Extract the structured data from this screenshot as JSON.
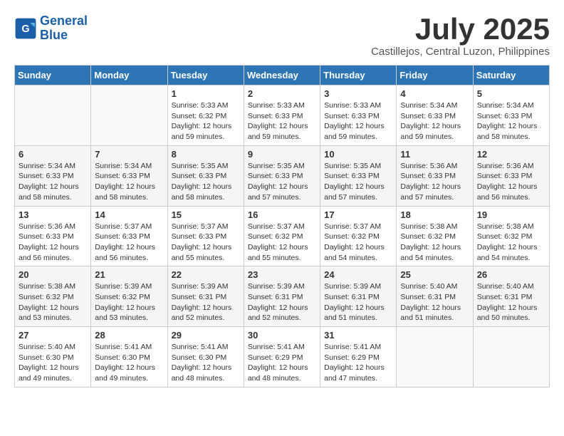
{
  "header": {
    "logo_line1": "General",
    "logo_line2": "Blue",
    "month": "July 2025",
    "location": "Castillejos, Central Luzon, Philippines"
  },
  "weekdays": [
    "Sunday",
    "Monday",
    "Tuesday",
    "Wednesday",
    "Thursday",
    "Friday",
    "Saturday"
  ],
  "weeks": [
    [
      {
        "day": "",
        "info": ""
      },
      {
        "day": "",
        "info": ""
      },
      {
        "day": "1",
        "info": "Sunrise: 5:33 AM\nSunset: 6:32 PM\nDaylight: 12 hours\nand 59 minutes."
      },
      {
        "day": "2",
        "info": "Sunrise: 5:33 AM\nSunset: 6:33 PM\nDaylight: 12 hours\nand 59 minutes."
      },
      {
        "day": "3",
        "info": "Sunrise: 5:33 AM\nSunset: 6:33 PM\nDaylight: 12 hours\nand 59 minutes."
      },
      {
        "day": "4",
        "info": "Sunrise: 5:34 AM\nSunset: 6:33 PM\nDaylight: 12 hours\nand 59 minutes."
      },
      {
        "day": "5",
        "info": "Sunrise: 5:34 AM\nSunset: 6:33 PM\nDaylight: 12 hours\nand 58 minutes."
      }
    ],
    [
      {
        "day": "6",
        "info": "Sunrise: 5:34 AM\nSunset: 6:33 PM\nDaylight: 12 hours\nand 58 minutes."
      },
      {
        "day": "7",
        "info": "Sunrise: 5:34 AM\nSunset: 6:33 PM\nDaylight: 12 hours\nand 58 minutes."
      },
      {
        "day": "8",
        "info": "Sunrise: 5:35 AM\nSunset: 6:33 PM\nDaylight: 12 hours\nand 58 minutes."
      },
      {
        "day": "9",
        "info": "Sunrise: 5:35 AM\nSunset: 6:33 PM\nDaylight: 12 hours\nand 57 minutes."
      },
      {
        "day": "10",
        "info": "Sunrise: 5:35 AM\nSunset: 6:33 PM\nDaylight: 12 hours\nand 57 minutes."
      },
      {
        "day": "11",
        "info": "Sunrise: 5:36 AM\nSunset: 6:33 PM\nDaylight: 12 hours\nand 57 minutes."
      },
      {
        "day": "12",
        "info": "Sunrise: 5:36 AM\nSunset: 6:33 PM\nDaylight: 12 hours\nand 56 minutes."
      }
    ],
    [
      {
        "day": "13",
        "info": "Sunrise: 5:36 AM\nSunset: 6:33 PM\nDaylight: 12 hours\nand 56 minutes."
      },
      {
        "day": "14",
        "info": "Sunrise: 5:37 AM\nSunset: 6:33 PM\nDaylight: 12 hours\nand 56 minutes."
      },
      {
        "day": "15",
        "info": "Sunrise: 5:37 AM\nSunset: 6:33 PM\nDaylight: 12 hours\nand 55 minutes."
      },
      {
        "day": "16",
        "info": "Sunrise: 5:37 AM\nSunset: 6:32 PM\nDaylight: 12 hours\nand 55 minutes."
      },
      {
        "day": "17",
        "info": "Sunrise: 5:37 AM\nSunset: 6:32 PM\nDaylight: 12 hours\nand 54 minutes."
      },
      {
        "day": "18",
        "info": "Sunrise: 5:38 AM\nSunset: 6:32 PM\nDaylight: 12 hours\nand 54 minutes."
      },
      {
        "day": "19",
        "info": "Sunrise: 5:38 AM\nSunset: 6:32 PM\nDaylight: 12 hours\nand 54 minutes."
      }
    ],
    [
      {
        "day": "20",
        "info": "Sunrise: 5:38 AM\nSunset: 6:32 PM\nDaylight: 12 hours\nand 53 minutes."
      },
      {
        "day": "21",
        "info": "Sunrise: 5:39 AM\nSunset: 6:32 PM\nDaylight: 12 hours\nand 53 minutes."
      },
      {
        "day": "22",
        "info": "Sunrise: 5:39 AM\nSunset: 6:31 PM\nDaylight: 12 hours\nand 52 minutes."
      },
      {
        "day": "23",
        "info": "Sunrise: 5:39 AM\nSunset: 6:31 PM\nDaylight: 12 hours\nand 52 minutes."
      },
      {
        "day": "24",
        "info": "Sunrise: 5:39 AM\nSunset: 6:31 PM\nDaylight: 12 hours\nand 51 minutes."
      },
      {
        "day": "25",
        "info": "Sunrise: 5:40 AM\nSunset: 6:31 PM\nDaylight: 12 hours\nand 51 minutes."
      },
      {
        "day": "26",
        "info": "Sunrise: 5:40 AM\nSunset: 6:31 PM\nDaylight: 12 hours\nand 50 minutes."
      }
    ],
    [
      {
        "day": "27",
        "info": "Sunrise: 5:40 AM\nSunset: 6:30 PM\nDaylight: 12 hours\nand 49 minutes."
      },
      {
        "day": "28",
        "info": "Sunrise: 5:41 AM\nSunset: 6:30 PM\nDaylight: 12 hours\nand 49 minutes."
      },
      {
        "day": "29",
        "info": "Sunrise: 5:41 AM\nSunset: 6:30 PM\nDaylight: 12 hours\nand 48 minutes."
      },
      {
        "day": "30",
        "info": "Sunrise: 5:41 AM\nSunset: 6:29 PM\nDaylight: 12 hours\nand 48 minutes."
      },
      {
        "day": "31",
        "info": "Sunrise: 5:41 AM\nSunset: 6:29 PM\nDaylight: 12 hours\nand 47 minutes."
      },
      {
        "day": "",
        "info": ""
      },
      {
        "day": "",
        "info": ""
      }
    ]
  ]
}
